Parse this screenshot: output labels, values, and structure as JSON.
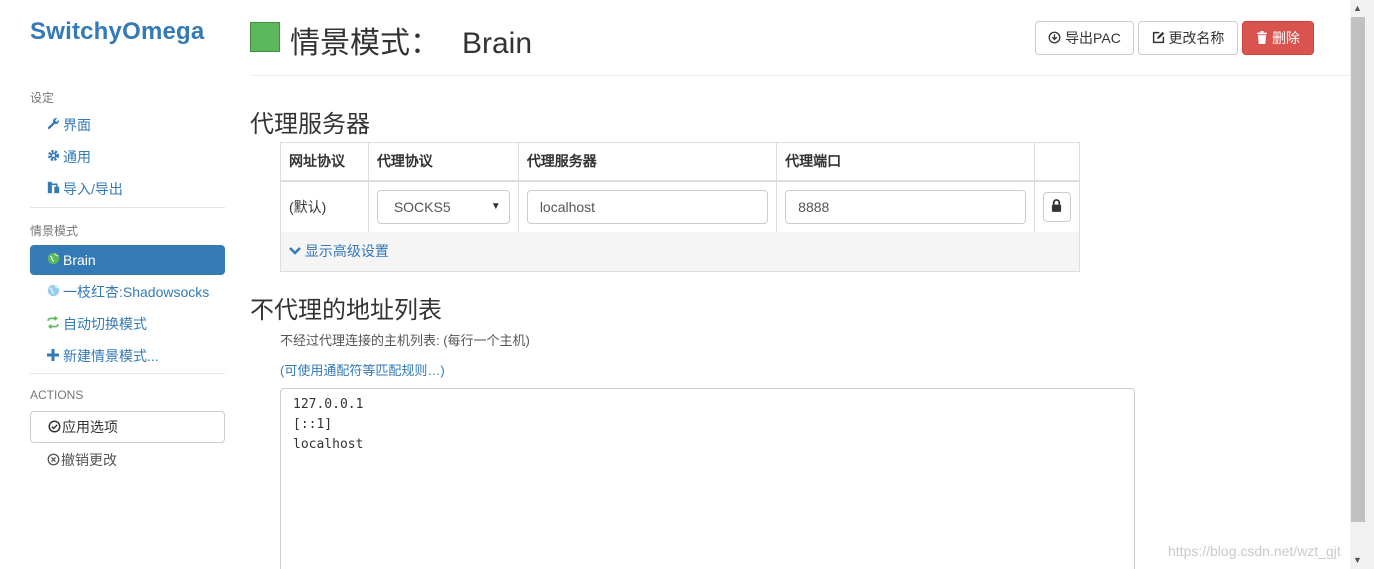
{
  "brand": "SwitchyOmega",
  "sidebar": {
    "settings_header": "设定",
    "settings_items": [
      {
        "label": "界面",
        "icon": "wrench-icon"
      },
      {
        "label": "通用",
        "icon": "gear-icon"
      },
      {
        "label": "导入/导出",
        "icon": "import-export-icon"
      }
    ],
    "profiles_header": "情景模式",
    "profile_items": [
      {
        "label": "Brain",
        "icon": "globe-icon",
        "color": "#5cb85c",
        "active": true
      },
      {
        "label": "一枝红杏:Shadowsocks",
        "icon": "globe-icon",
        "color": "#99ccee"
      },
      {
        "label": "自动切换模式",
        "icon": "switch-icon",
        "color": "#5cb85c"
      },
      {
        "label": "新建情景模式...",
        "icon": "plus-icon"
      }
    ],
    "actions_header": "ACTIONS",
    "apply_label": "应用选项",
    "discard_label": "撤销更改"
  },
  "header": {
    "title_prefix": "情景模式：",
    "profile_name": "Brain",
    "profile_color": "#5cb85c",
    "export_pac_label": "导出PAC",
    "rename_label": "更改名称",
    "delete_label": "删除"
  },
  "proxy": {
    "section_title": "代理服务器",
    "columns": [
      "网址协议",
      "代理协议",
      "代理服务器",
      "代理端口"
    ],
    "row": {
      "scheme": "(默认)",
      "protocol": "SOCKS5",
      "server": "localhost",
      "port": "8888"
    },
    "advanced_label": "显示高级设置"
  },
  "bypass": {
    "section_title": "不代理的地址列表",
    "help_text": "不经过代理连接的主机列表: (每行一个主机)",
    "wildcard_link": "(可使用通配符等匹配规则…)",
    "entries": [
      "127.0.0.1",
      "[::1]",
      "localhost"
    ]
  },
  "watermark": "https://blog.csdn.net/wzt_gjt"
}
